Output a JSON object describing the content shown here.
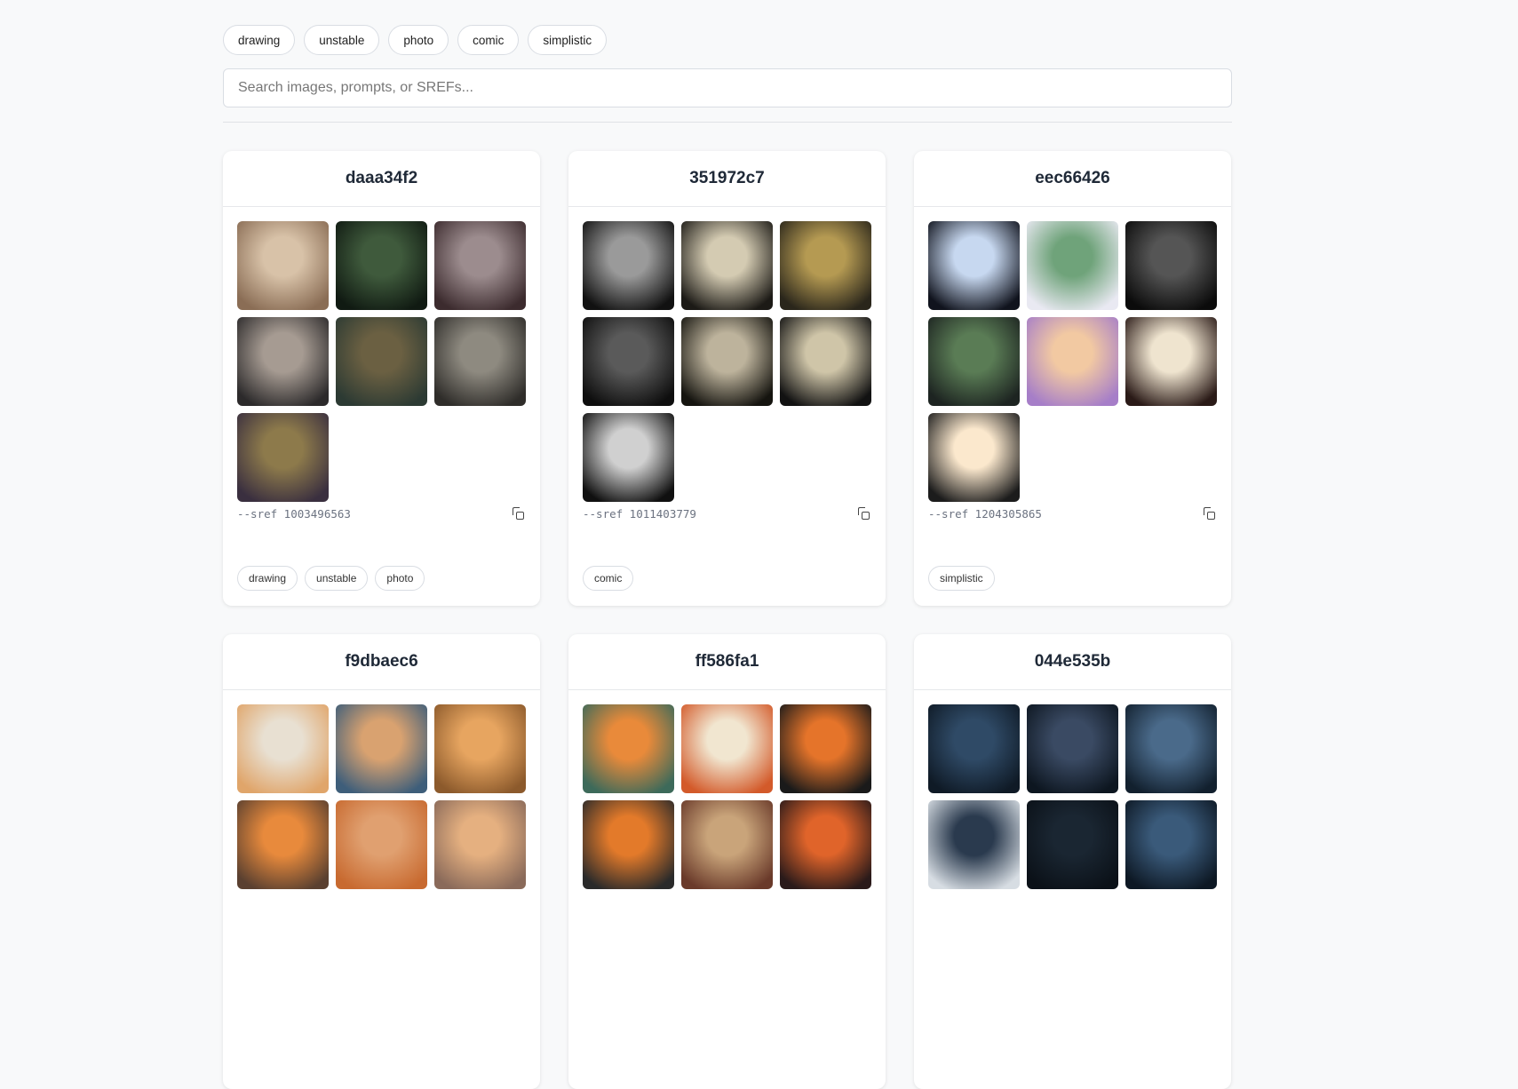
{
  "filters": [
    "drawing",
    "unstable",
    "photo",
    "comic",
    "simplistic"
  ],
  "search": {
    "placeholder": "Search images, prompts, or SREFs..."
  },
  "cards": [
    {
      "id": "daaa34f2",
      "sref": "--sref 1003496563",
      "tags": [
        "drawing",
        "unstable",
        "photo"
      ],
      "thumbs": [
        [
          "#d8c2a8",
          "#8a6d55"
        ],
        [
          "#3f5a3c",
          "#101a12"
        ],
        [
          "#9c8c8e",
          "#3c2b2e"
        ],
        [
          "#a69b92",
          "#2c2a2b"
        ],
        [
          "#6b6042",
          "#2c3a33"
        ],
        [
          "#8e8a80",
          "#2f2d2a"
        ],
        [
          "#8d7a4b",
          "#3a2f3f"
        ]
      ]
    },
    {
      "id": "351972c7",
      "sref": "--sref 1011403779",
      "tags": [
        "comic"
      ],
      "thumbs": [
        [
          "#9a9a9a",
          "#111111"
        ],
        [
          "#d4cbb2",
          "#1c1a16"
        ],
        [
          "#b59a52",
          "#2a261b"
        ],
        [
          "#5a5a5a",
          "#0e0e0e"
        ],
        [
          "#bdb39c",
          "#15140f"
        ],
        [
          "#cfc5a8",
          "#121212"
        ],
        [
          "#d0d0d0",
          "#101010"
        ]
      ]
    },
    {
      "id": "eec66426",
      "sref": "--sref 1204305865",
      "tags": [
        "simplistic"
      ],
      "thumbs": [
        [
          "#c7d8f0",
          "#10131d"
        ],
        [
          "#6fa37a",
          "#e9e9f2"
        ],
        [
          "#555555",
          "#0b0b0b"
        ],
        [
          "#5a7c55",
          "#1d2421"
        ],
        [
          "#f2c9a2",
          "#a67ec8"
        ],
        [
          "#efe4cf",
          "#2a1a17"
        ],
        [
          "#fbe8cd",
          "#1c1c1c"
        ]
      ]
    },
    {
      "id": "f9dbaec6",
      "sref": "",
      "tags": [],
      "thumbs": [
        [
          "#e8e0d2",
          "#e0a56a"
        ],
        [
          "#d9a270",
          "#3e5e7a"
        ],
        [
          "#e7a560",
          "#8c5a2c"
        ],
        [
          "#e88a3c",
          "#5a4030"
        ],
        [
          "#e0a070",
          "#c86a30"
        ],
        [
          "#e5b080",
          "#8a6a5a"
        ]
      ]
    },
    {
      "id": "ff586fa1",
      "sref": "",
      "tags": [],
      "thumbs": [
        [
          "#e98a3a",
          "#3d6a5a"
        ],
        [
          "#f1e6d0",
          "#d35a2a"
        ],
        [
          "#e5742a",
          "#1a1a1a"
        ],
        [
          "#e37a2a",
          "#2a2a2a"
        ],
        [
          "#c9a47a",
          "#6a3a2a"
        ],
        [
          "#e0642a",
          "#2a1a1a"
        ]
      ]
    },
    {
      "id": "044e535b",
      "sref": "",
      "tags": [],
      "thumbs": [
        [
          "#2f4a66",
          "#0f1a26"
        ],
        [
          "#3a4a63",
          "#0d1620"
        ],
        [
          "#4a6a8a",
          "#12202e"
        ],
        [
          "#2a3a4e",
          "#d7dde3"
        ],
        [
          "#1a2632",
          "#0b1118"
        ],
        [
          "#3a5a7a",
          "#0d1824"
        ]
      ]
    }
  ]
}
